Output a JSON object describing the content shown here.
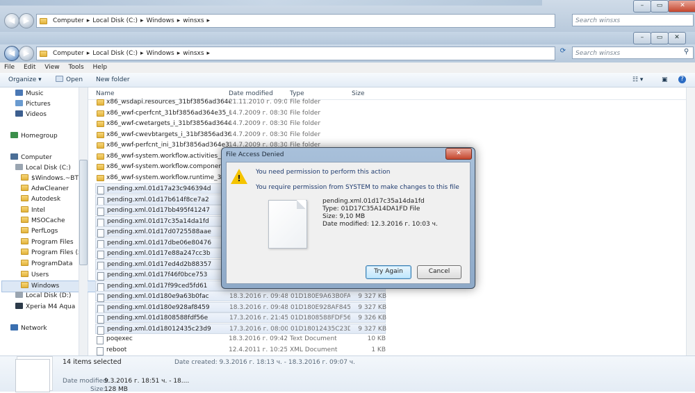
{
  "window": {
    "path": [
      "Computer",
      "Local Disk (C:)",
      "Windows",
      "winsxs"
    ],
    "search_placeholder": "Search winsxs",
    "caption_min": "–",
    "caption_max": "▭",
    "caption_close": "✕"
  },
  "menu": [
    "File",
    "Edit",
    "View",
    "Tools",
    "Help"
  ],
  "toolbar": {
    "organize": "Organize ▾",
    "open": "Open",
    "new_folder": "New folder"
  },
  "sidebar": [
    {
      "label": "Music",
      "icon": "music-icon"
    },
    {
      "label": "Pictures",
      "icon": "pictures-icon"
    },
    {
      "label": "Videos",
      "icon": "videos-icon"
    },
    {
      "label": "Homegroup",
      "icon": "homegroup-icon"
    },
    {
      "label": "Computer",
      "icon": "computer-icon"
    },
    {
      "label": "Local Disk (C:)",
      "icon": "drive-icon"
    },
    {
      "label": "$Windows.~BT",
      "icon": "folder-icon"
    },
    {
      "label": "AdwCleaner",
      "icon": "folder-icon"
    },
    {
      "label": "Autodesk",
      "icon": "folder-icon"
    },
    {
      "label": "Intel",
      "icon": "folder-icon"
    },
    {
      "label": "MSOCache",
      "icon": "folder-icon"
    },
    {
      "label": "PerfLogs",
      "icon": "folder-icon"
    },
    {
      "label": "Program Files",
      "icon": "folder-icon"
    },
    {
      "label": "Program Files (x8",
      "icon": "folder-icon"
    },
    {
      "label": "ProgramData",
      "icon": "folder-icon"
    },
    {
      "label": "Users",
      "icon": "folder-icon"
    },
    {
      "label": "Windows",
      "icon": "folder-icon"
    },
    {
      "label": "Local Disk (D:)",
      "icon": "drive-icon"
    },
    {
      "label": "Xperia M4 Aqua",
      "icon": "phone-icon"
    },
    {
      "label": "Network",
      "icon": "network-icon"
    }
  ],
  "columns": {
    "name": "Name",
    "date": "Date modified",
    "type": "Type",
    "size": "Size"
  },
  "files": [
    {
      "name": "x86_wsdapi.resources_31bf3856ad364e35...",
      "date": "21.11.2010 г. 09:06...",
      "type": "File folder",
      "size": "",
      "kind": "folder",
      "selected": false
    },
    {
      "name": "x86_wwf-cperfcnt_31bf3856ad364e35_6.1....",
      "date": "14.7.2009 г. 08:30 ч.",
      "type": "File folder",
      "size": "",
      "kind": "folder",
      "selected": false
    },
    {
      "name": "x86_wwf-cwetargets_i_31bf3856ad364e35...",
      "date": "14.7.2009 г. 08:30 ч.",
      "type": "File folder",
      "size": "",
      "kind": "folder",
      "selected": false
    },
    {
      "name": "x86_wwf-cwevbtargets_i_31bf3856ad364e...",
      "date": "14.7.2009 г. 08:30 ч.",
      "type": "File folder",
      "size": "",
      "kind": "folder",
      "selected": false
    },
    {
      "name": "x86_wwf-perfcnt_ini_31bf3856ad364e35_6....",
      "date": "14.7.2009 г. 08:30 ч.",
      "type": "File folder",
      "size": "",
      "kind": "folder",
      "selected": false
    },
    {
      "name": "x86_wwf-system.workflow.activities_31bf...",
      "date": "",
      "type": "",
      "size": "",
      "kind": "folder",
      "selected": false
    },
    {
      "name": "x86_wwf-system.workflow.componentm...",
      "date": "",
      "type": "",
      "size": "",
      "kind": "folder",
      "selected": false
    },
    {
      "name": "x86_wwf-system.workflow.runtime_31bf3...",
      "date": "",
      "type": "",
      "size": "",
      "kind": "folder",
      "selected": false
    },
    {
      "name": "pending.xml.01d17a23c946394d",
      "date": "",
      "type": "",
      "size": "",
      "kind": "file",
      "selected": true
    },
    {
      "name": "pending.xml.01d17b614f8ce7a2",
      "date": "",
      "type": "",
      "size": "",
      "kind": "file",
      "selected": true
    },
    {
      "name": "pending.xml.01d17bb495f41247",
      "date": "",
      "type": "",
      "size": "",
      "kind": "file",
      "selected": true
    },
    {
      "name": "pending.xml.01d17c35a14da1fd",
      "date": "",
      "type": "",
      "size": "",
      "kind": "file",
      "selected": true
    },
    {
      "name": "pending.xml.01d17d0725588aae",
      "date": "",
      "type": "",
      "size": "",
      "kind": "file",
      "selected": true
    },
    {
      "name": "pending.xml.01d17dbe06e80476",
      "date": "",
      "type": "",
      "size": "",
      "kind": "file",
      "selected": true
    },
    {
      "name": "pending.xml.01d17e88a247cc3b",
      "date": "",
      "type": "",
      "size": "",
      "kind": "file",
      "selected": true
    },
    {
      "name": "pending.xml.01d17ed4d2b88357",
      "date": "",
      "type": "",
      "size": "",
      "kind": "file",
      "selected": true
    },
    {
      "name": "pending.xml.01d17f46f0bce753",
      "date": "",
      "type": "",
      "size": "",
      "kind": "file",
      "selected": true
    },
    {
      "name": "pending.xml.01d17f99ced5fd61",
      "date": "",
      "type": "",
      "size": "",
      "kind": "file",
      "selected": true
    },
    {
      "name": "pending.xml.01d180e9a63b0fac",
      "date": "18.3.2016 г. 09:48 ч.",
      "type": "01D180E9A63B0FA...",
      "size": "9 327 KB",
      "kind": "file",
      "selected": true
    },
    {
      "name": "pending.xml.01d180e928af8459",
      "date": "18.3.2016 г. 09:48 ч.",
      "type": "01D180E928AF845...",
      "size": "9 327 KB",
      "kind": "file",
      "selected": true
    },
    {
      "name": "pending.xml.01d1808588fdf56e",
      "date": "17.3.2016 г. 21:45 ч.",
      "type": "01D1808588FDF56...",
      "size": "9 326 KB",
      "kind": "file",
      "selected": true
    },
    {
      "name": "pending.xml.01d18012435c23d9",
      "date": "17.3.2016 г. 08:00 ч.",
      "type": "01D18012435C23D...",
      "size": "9 327 KB",
      "kind": "file",
      "selected": true
    },
    {
      "name": "poqexec",
      "date": "18.3.2016 г. 09:42 ч.",
      "type": "Text Document",
      "size": "10 KB",
      "kind": "file",
      "selected": false
    },
    {
      "name": "reboot",
      "date": "12.4.2011 г. 10:25 ч.",
      "type": "XML Document",
      "size": "1 KB",
      "kind": "file",
      "selected": false
    }
  ],
  "status": {
    "count": "14 items selected",
    "created": "Date created: 9.3.2016 г. 18:13 ч. - 18.3.2016 г. 09:07 ч.",
    "modified_label": "Date modified:",
    "modified_value": "9.3.2016 г. 18:51 ч. - 18....",
    "size_label": "Size:",
    "size_value": "128 MB"
  },
  "dialog": {
    "title": "File Access Denied",
    "heading": "You need permission to perform this action",
    "message": "You require permission from SYSTEM to make changes to this file",
    "file_name": "pending.xml.01d17c35a14da1fd",
    "file_type": "Type: 01D17C35A14DA1FD File",
    "file_size": "Size: 9,10 MB",
    "file_modified": "Date modified: 12.3.2016 г. 10:03 ч.",
    "try_again": "Try Again",
    "cancel": "Cancel",
    "close": "✕",
    "warn_mark": "!"
  }
}
